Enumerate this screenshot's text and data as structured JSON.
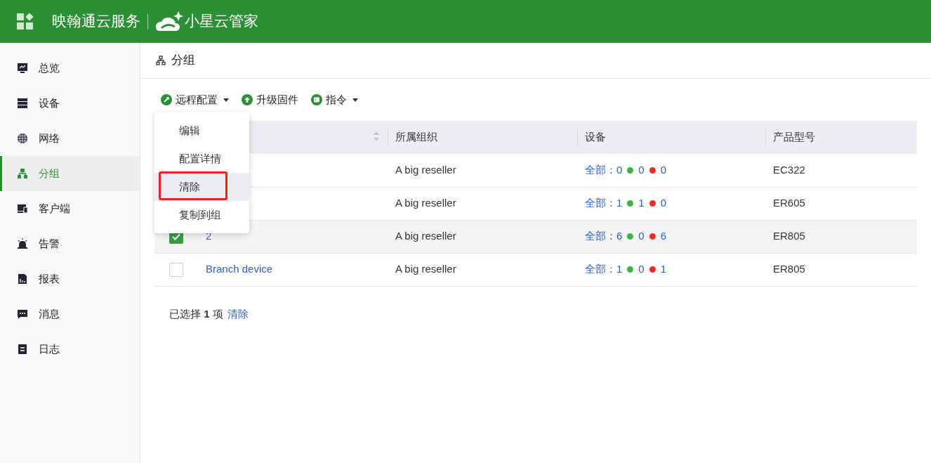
{
  "header": {
    "brand": "映翰通云服务",
    "product": "小星云管家"
  },
  "sidebar": {
    "items": [
      {
        "label": "总览",
        "selected": false
      },
      {
        "label": "设备",
        "selected": false
      },
      {
        "label": "网络",
        "selected": false
      },
      {
        "label": "分组",
        "selected": true
      },
      {
        "label": "客户端",
        "selected": false
      },
      {
        "label": "告警",
        "selected": false
      },
      {
        "label": "报表",
        "selected": false
      },
      {
        "label": "消息",
        "selected": false
      },
      {
        "label": "日志",
        "selected": false
      }
    ]
  },
  "page": {
    "title": "分组"
  },
  "toolbar": [
    {
      "label": "远程配置",
      "dropdown": true
    },
    {
      "label": "升级固件",
      "dropdown": false
    },
    {
      "label": "指令",
      "dropdown": true
    }
  ],
  "menu": {
    "items": [
      {
        "label": "编辑",
        "hovered": false,
        "highlighted": false
      },
      {
        "label": "配置详情",
        "hovered": false,
        "highlighted": false
      },
      {
        "label": "清除",
        "hovered": true,
        "highlighted": true
      },
      {
        "label": "复制到组",
        "hovered": false,
        "highlighted": false
      }
    ]
  },
  "table": {
    "columns": [
      "所属组织",
      "设备",
      "产品型号"
    ],
    "rows": [
      {
        "org": "A big reseller",
        "all": "全部：0",
        "online": "0",
        "offline": "0",
        "model": "EC322",
        "selected": false
      },
      {
        "org": "A big reseller",
        "all": "全部：1",
        "online": "1",
        "offline": "0",
        "model": "ER605",
        "selected": false
      },
      {
        "checked": true,
        "name": "2",
        "org": "A big reseller",
        "all": "全部：6",
        "online": "0",
        "offline": "6",
        "model": "ER805",
        "selected": true
      },
      {
        "checked": false,
        "name": "Branch device",
        "org": "A big reseller",
        "all": "全部：1",
        "online": "0",
        "offline": "1",
        "model": "ER805",
        "selected": false
      }
    ]
  },
  "footer": {
    "summary": "已选择 **1** 项",
    "clear": "清除"
  }
}
